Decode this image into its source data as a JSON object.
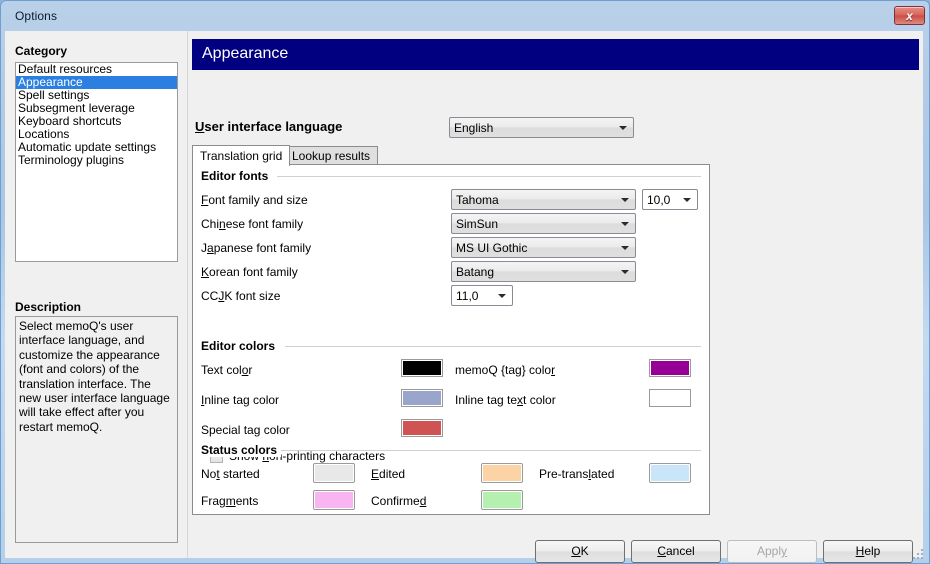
{
  "window": {
    "title": "Options",
    "close_label": "x"
  },
  "sidebar": {
    "category_label": "Category",
    "items": [
      {
        "label": "Default resources",
        "selected": false
      },
      {
        "label": "Appearance",
        "selected": true
      },
      {
        "label": "Spell settings",
        "selected": false
      },
      {
        "label": "Subsegment leverage",
        "selected": false
      },
      {
        "label": "Keyboard shortcuts",
        "selected": false
      },
      {
        "label": "Locations",
        "selected": false
      },
      {
        "label": "Automatic update settings",
        "selected": false
      },
      {
        "label": "Terminology plugins",
        "selected": false
      }
    ],
    "description_label": "Description",
    "description_text": "Select memoQ's user interface language, and customize the appearance (font and colors) of the translation interface. The new user interface language will take effect after you restart memoQ."
  },
  "main": {
    "banner_title": "Appearance",
    "banner_color": "#000080",
    "ui_language": {
      "label_prefix": "U",
      "label_rest": "ser interface language",
      "value": "English"
    },
    "tabs": [
      {
        "label": "Translation grid",
        "active": true
      },
      {
        "label": "Lookup results",
        "active": false
      }
    ],
    "editor_fonts": {
      "group_title": "Editor fonts",
      "rows": [
        {
          "label_a": "F",
          "label_b": "ont family and size",
          "value": "Tahoma"
        },
        {
          "label_a": "Chi",
          "label_b": "n",
          "label_c": "ese font family",
          "value": "SimSun"
        },
        {
          "label_a": "J",
          "label_b": "a",
          "label_c": "panese font family",
          "value": "MS UI Gothic"
        },
        {
          "label_a": "K",
          "label_b": "orean font family",
          "value": "Batang"
        }
      ],
      "font_size": "10,0",
      "ccjk_label_a": "CC",
      "ccjk_label_b": "J",
      "ccjk_label_c": "K font size",
      "ccjk_size": "11,0",
      "checkbox": {
        "label_a": "Show ",
        "label_b": "n",
        "label_c": "on-printing characters",
        "checked": false
      }
    },
    "editor_colors": {
      "group_title": "Editor colors",
      "items": [
        {
          "label_a": "Text col",
          "label_b": "o",
          "label_c": "r",
          "color": "#000000"
        },
        {
          "label_a": "",
          "label_b": "I",
          "label_c": "nline tag color",
          "color": "#9aa5cc"
        },
        {
          "label_a": "Special ta",
          "label_b": "g",
          "label_c": " color",
          "color": "#cf5353"
        },
        {
          "label_a": "memoQ {tag} colo",
          "label_b": "r",
          "label_c": "",
          "color": "#960096"
        },
        {
          "label_a": "Inline tag te",
          "label_b": "x",
          "label_c": "t color",
          "color": "#ffffff"
        }
      ]
    },
    "status_colors": {
      "group_title": "Status colors",
      "items": [
        {
          "label_a": "No",
          "label_b": "t",
          "label_c": " started",
          "color": "#e8e8e8"
        },
        {
          "label_a": "",
          "label_b": "E",
          "label_c": "dited",
          "color": "#fbd3a5"
        },
        {
          "label_a": "Pre-trans",
          "label_b": "l",
          "label_c": "ated",
          "color": "#c9e5fa"
        },
        {
          "label_a": "Frag",
          "label_b": "m",
          "label_c": "ents",
          "color": "#f9b4f2"
        },
        {
          "label_a": "Confirme",
          "label_b": "d",
          "label_c": "",
          "color": "#b6f0b0"
        }
      ]
    }
  },
  "footer": {
    "buttons": [
      {
        "label_a": "O",
        "label_b": "K",
        "disabled": false,
        "name": "ok-button"
      },
      {
        "label_a": "C",
        "label_b": "ancel",
        "disabled": false,
        "name": "cancel-button"
      },
      {
        "label_a": "Appl",
        "label_b": "y",
        "disabled": true,
        "name": "apply-button"
      },
      {
        "label_a": "H",
        "label_b": "elp",
        "disabled": false,
        "name": "help-button"
      }
    ]
  }
}
